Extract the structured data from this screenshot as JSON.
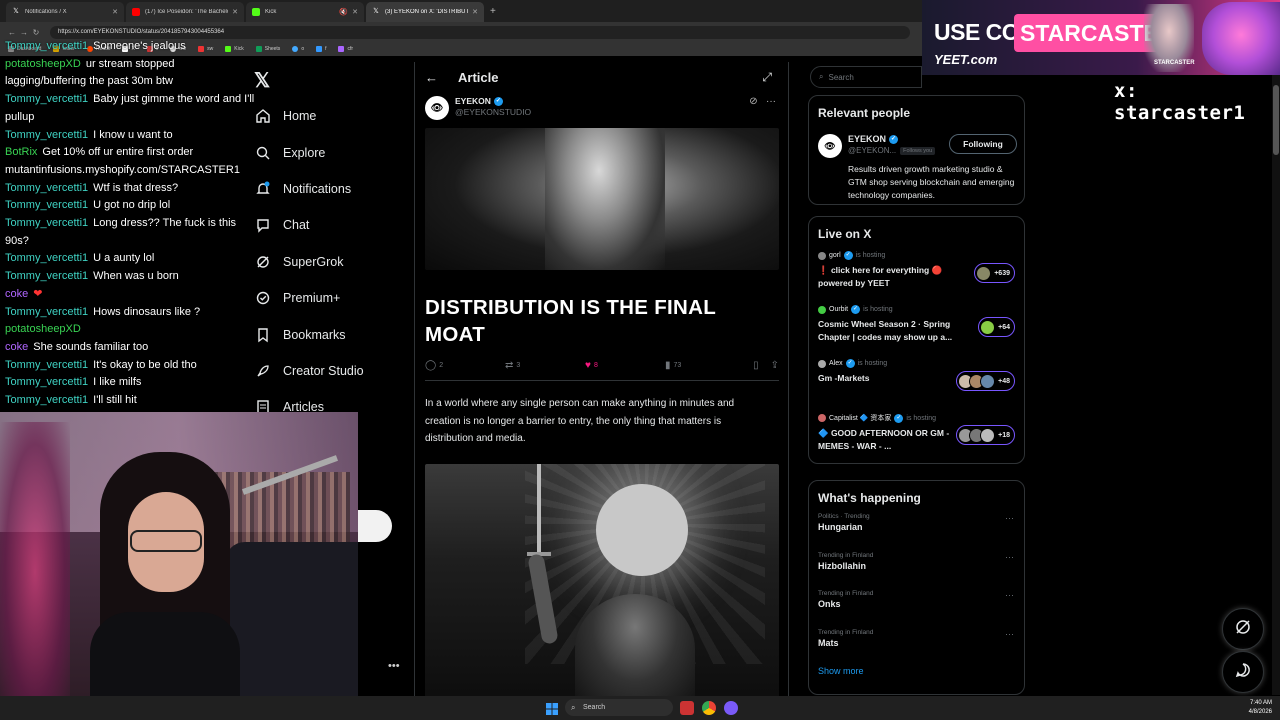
{
  "browser": {
    "tabs": [
      {
        "title": "Notifications / X",
        "active": false,
        "favicon": "X"
      },
      {
        "title": "(17) Ice Poseidon: 'The Bachelo...",
        "active": false,
        "favicon": "yt"
      },
      {
        "title": "Kick",
        "active": false,
        "favicon": "K"
      },
      {
        "title": "(3) EYEKON on X: 'DISTRIBUTIO...",
        "active": true,
        "favicon": "X"
      }
    ],
    "new_tab": "+",
    "url": "https://x.com/EYEKONSTUDIO/status/2041857943004455364",
    "bookmarks": [
      "Dashboard",
      "folder",
      "Reddit",
      "X",
      "ff",
      "mv",
      "sw",
      "Kick",
      "Sheets",
      "o",
      "f",
      "cfr"
    ]
  },
  "chat": [
    {
      "user": "Tommy_vercetti1",
      "msg": "Someone's jealous",
      "color": "teal"
    },
    {
      "user": "potatosheepXD",
      "msg": "ur stream stopped lagging/buffering the past 30m btw",
      "color": "green"
    },
    {
      "user": "Tommy_vercetti1",
      "msg": "Baby just gimme the word and I'll pullup",
      "color": "teal"
    },
    {
      "user": "Tommy_vercetti1",
      "msg": "I know u want to",
      "color": "teal"
    },
    {
      "user": "BotRix",
      "msg": "Get 10% off ur entire first order mutantinfusions.myshopify.com/STARCASTER1",
      "color": "green"
    },
    {
      "user": "Tommy_vercetti1",
      "msg": "Wtf is that dress?",
      "color": "teal"
    },
    {
      "user": "Tommy_vercetti1",
      "msg": "U got no drip lol",
      "color": "teal"
    },
    {
      "user": "Tommy_vercetti1",
      "msg": "Long dress?? The fuck is this 90s?",
      "color": "teal"
    },
    {
      "user": "Tommy_vercetti1",
      "msg": "U a aunty lol",
      "color": "teal"
    },
    {
      "user": "Tommy_vercetti1",
      "msg": "When was u born",
      "color": "teal"
    },
    {
      "user": "coke",
      "msg": "❤",
      "color": "purple"
    },
    {
      "user": "Tommy_vercetti1",
      "msg": "Hows dinosaurs like ?",
      "color": "teal"
    },
    {
      "user": "potatosheepXD",
      "msg": "",
      "color": "green"
    },
    {
      "user": "coke",
      "msg": "She sounds familiar too",
      "color": "purple"
    },
    {
      "user": "Tommy_vercetti1",
      "msg": "It's okay to be old tho",
      "color": "teal"
    },
    {
      "user": "Tommy_vercetti1",
      "msg": "I like milfs",
      "color": "teal"
    },
    {
      "user": "Tommy_vercetti1",
      "msg": "I'll still hit",
      "color": "teal"
    }
  ],
  "nav": {
    "logo": "X",
    "items": [
      {
        "label": "Home",
        "icon": "home-icon"
      },
      {
        "label": "Explore",
        "icon": "search-icon"
      },
      {
        "label": "Notifications",
        "icon": "bell-icon"
      },
      {
        "label": "Chat",
        "icon": "chat-icon"
      },
      {
        "label": "SuperGrok",
        "icon": "grok-icon"
      },
      {
        "label": "Premium+",
        "icon": "premium-icon"
      },
      {
        "label": "Bookmarks",
        "icon": "bookmark-icon"
      },
      {
        "label": "Creator Studio",
        "icon": "rocket-icon"
      },
      {
        "label": "Articles",
        "icon": "article-icon"
      }
    ],
    "more": "•••"
  },
  "article": {
    "header": "Article",
    "author_name": "EYEKON",
    "author_handle": "@EYEKONSTUDIO",
    "headline": "DISTRIBUTION IS THE FINAL MOAT",
    "stats": {
      "replies": "2",
      "reposts": "3",
      "likes": "8",
      "views": "73"
    },
    "body": "In a world where any single person can make anything in minutes and creation is no longer a barrier to entry, the only thing that matters is distribution and media."
  },
  "sidebar": {
    "search_placeholder": "Search",
    "relevant": {
      "title": "Relevant people",
      "name": "EYEKON",
      "handle": "@EYEKON...",
      "follows_you": "Follows you",
      "follow_label": "Following",
      "bio": "Results driven growth marketing studio & GTM shop serving blockchain and emerging technology companies."
    },
    "live": {
      "title": "Live on X",
      "items": [
        {
          "host": "gorl",
          "hosting": "is hosting",
          "title": "❗ click here for everything 🔴 powered by YEET",
          "count": "+639"
        },
        {
          "host": "Ourbit",
          "hosting": "is hosting",
          "title": "Cosmic Wheel Season 2 · Spring Chapter | codes may show up a...",
          "count": "+64"
        },
        {
          "host": "Alex",
          "hosting": "is hosting",
          "title": "Gm -Markets",
          "count": "+48"
        },
        {
          "host": "Capitalist 🔷 资本家",
          "hosting": "is hosting",
          "title": "🔷 GOOD AFTERNOON OR GM - MEMES - WAR - ...",
          "count": "+18"
        }
      ]
    },
    "happening": {
      "title": "What's happening",
      "items": [
        {
          "context": "Politics · Trending",
          "name": "Hungarian"
        },
        {
          "context": "Trending in Finland",
          "name": "Hizbollahin"
        },
        {
          "context": "Trending in Finland",
          "name": "Onks"
        },
        {
          "context": "Trending in Finland",
          "name": "Mats"
        }
      ],
      "show_more": "Show more"
    }
  },
  "overlay": {
    "use_code": "USE CODE:",
    "code": "STARCASTER",
    "yeet": "YEET.com",
    "sc_label": "STARCASTER",
    "handle": "x: starcaster1"
  },
  "taskbar": {
    "search": "Search",
    "time": "7:40 AM",
    "date": "4/8/2026"
  }
}
